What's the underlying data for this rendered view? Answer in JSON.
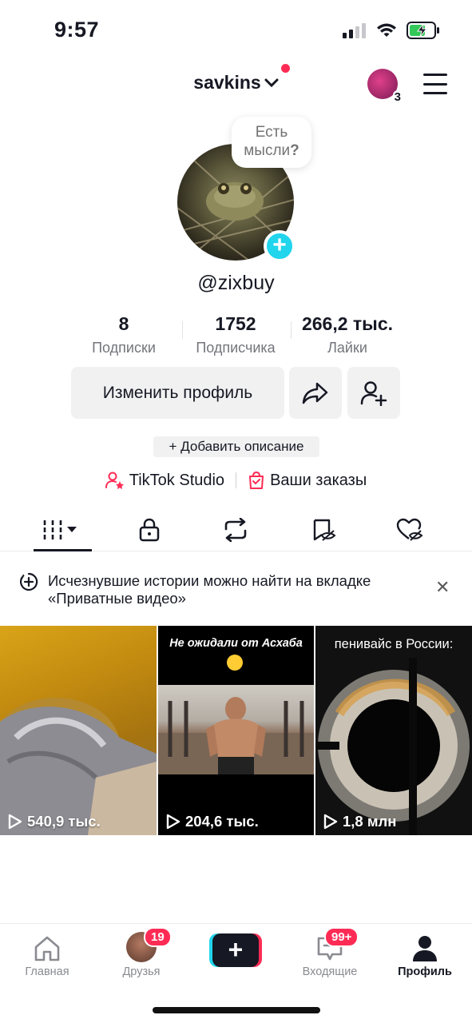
{
  "status_bar": {
    "time": "9:57"
  },
  "header": {
    "username": "savkins",
    "avatar_count": "3"
  },
  "profile": {
    "thought_bubble_line1": "Есть",
    "thought_bubble_line2": "мысли",
    "thought_bubble_mark": "?",
    "handle": "@zixbuy",
    "stats": [
      {
        "value": "8",
        "label": "Подписки"
      },
      {
        "value": "1752",
        "label": "Подписчика"
      },
      {
        "value": "266,2 тыс.",
        "label": "Лайки"
      }
    ],
    "edit_profile_label": "Изменить профиль",
    "add_description_label": "+ Добавить описание",
    "tiktok_studio_label": "TikTok Studio",
    "orders_label": "Ваши заказы"
  },
  "notice": {
    "text": "Исчезнувшие истории можно найти на вкладке «Приватные видео»",
    "close_glyph": "✕"
  },
  "videos": [
    {
      "views": "540,9 тыс.",
      "caption": ""
    },
    {
      "views": "204,6 тыс.",
      "caption": "Не ожидали от Асхаба"
    },
    {
      "views": "1,8 млн",
      "caption": "пенивайс в России:"
    }
  ],
  "bottom_nav": {
    "home": "Главная",
    "friends": "Друзья",
    "friends_badge": "19",
    "inbox": "Входящие",
    "inbox_badge": "99+",
    "profile": "Профиль",
    "create_glyph": "+"
  },
  "colors": {
    "accent_red": "#fe2c55",
    "accent_cyan": "#20d5ec",
    "text_primary": "#161823",
    "text_secondary": "#73757c"
  }
}
